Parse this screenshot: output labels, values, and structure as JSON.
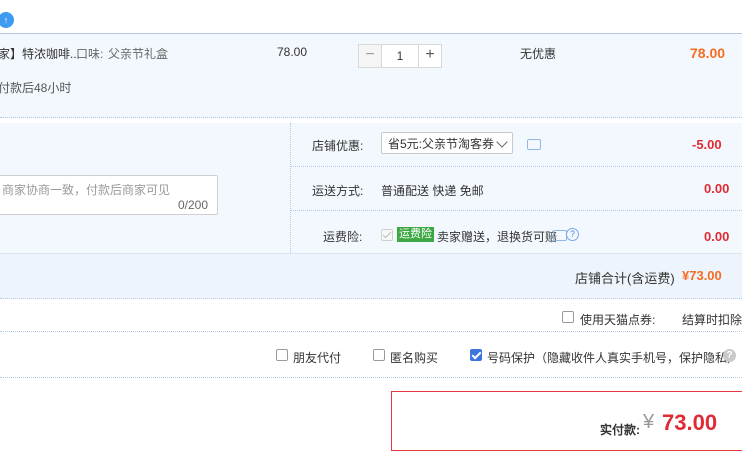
{
  "top": {
    "icon_glyph": "↑"
  },
  "item": {
    "title": "家】特浓咖啡...",
    "flavor_label": "口味:",
    "flavor_value": "父亲节礼盒",
    "unit_price": "78.00",
    "quantity": "1",
    "discount": "无优惠",
    "total": "78.00",
    "shipping_note": "付款后48小时",
    "minus_glyph": "−",
    "plus_glyph": "+"
  },
  "message": {
    "placeholder": "商家协商一致，付款后商家可见",
    "counter": "0/200"
  },
  "shop": {
    "coupon_label": "店铺优惠:",
    "coupon_value": "省5元:父亲节淘客券",
    "coupon_amount": "-5.00",
    "delivery_label": "运送方式:",
    "delivery_value": "普通配送 快递 免邮",
    "delivery_amount": "0.00",
    "insurance_label": "运费险:",
    "insurance_badge": "运费险",
    "insurance_text": "卖家赠送，退换货可赔",
    "insurance_amount": "0.00",
    "help_glyph": "?",
    "subtotal_label": "店铺合计(含运费)",
    "subtotal_value": "¥73.00"
  },
  "tmall": {
    "label": "使用天猫点券:",
    "note": "结算时扣除"
  },
  "options": [
    {
      "label": "朋友代付",
      "checked": false
    },
    {
      "label": "匿名购买",
      "checked": false
    },
    {
      "label": "号码保护（隐藏收件人真实手机号，保护隐私）",
      "checked": true
    }
  ],
  "pay": {
    "label": "实付款:",
    "currency": "¥",
    "amount": "73.00"
  },
  "colors": {
    "accent_red": "#e02a34",
    "accent_orange": "#f56c1f",
    "panel_blue": "#f3f8fe",
    "checkbox_blue": "#3b76e0",
    "badge_green": "#3ba843"
  }
}
